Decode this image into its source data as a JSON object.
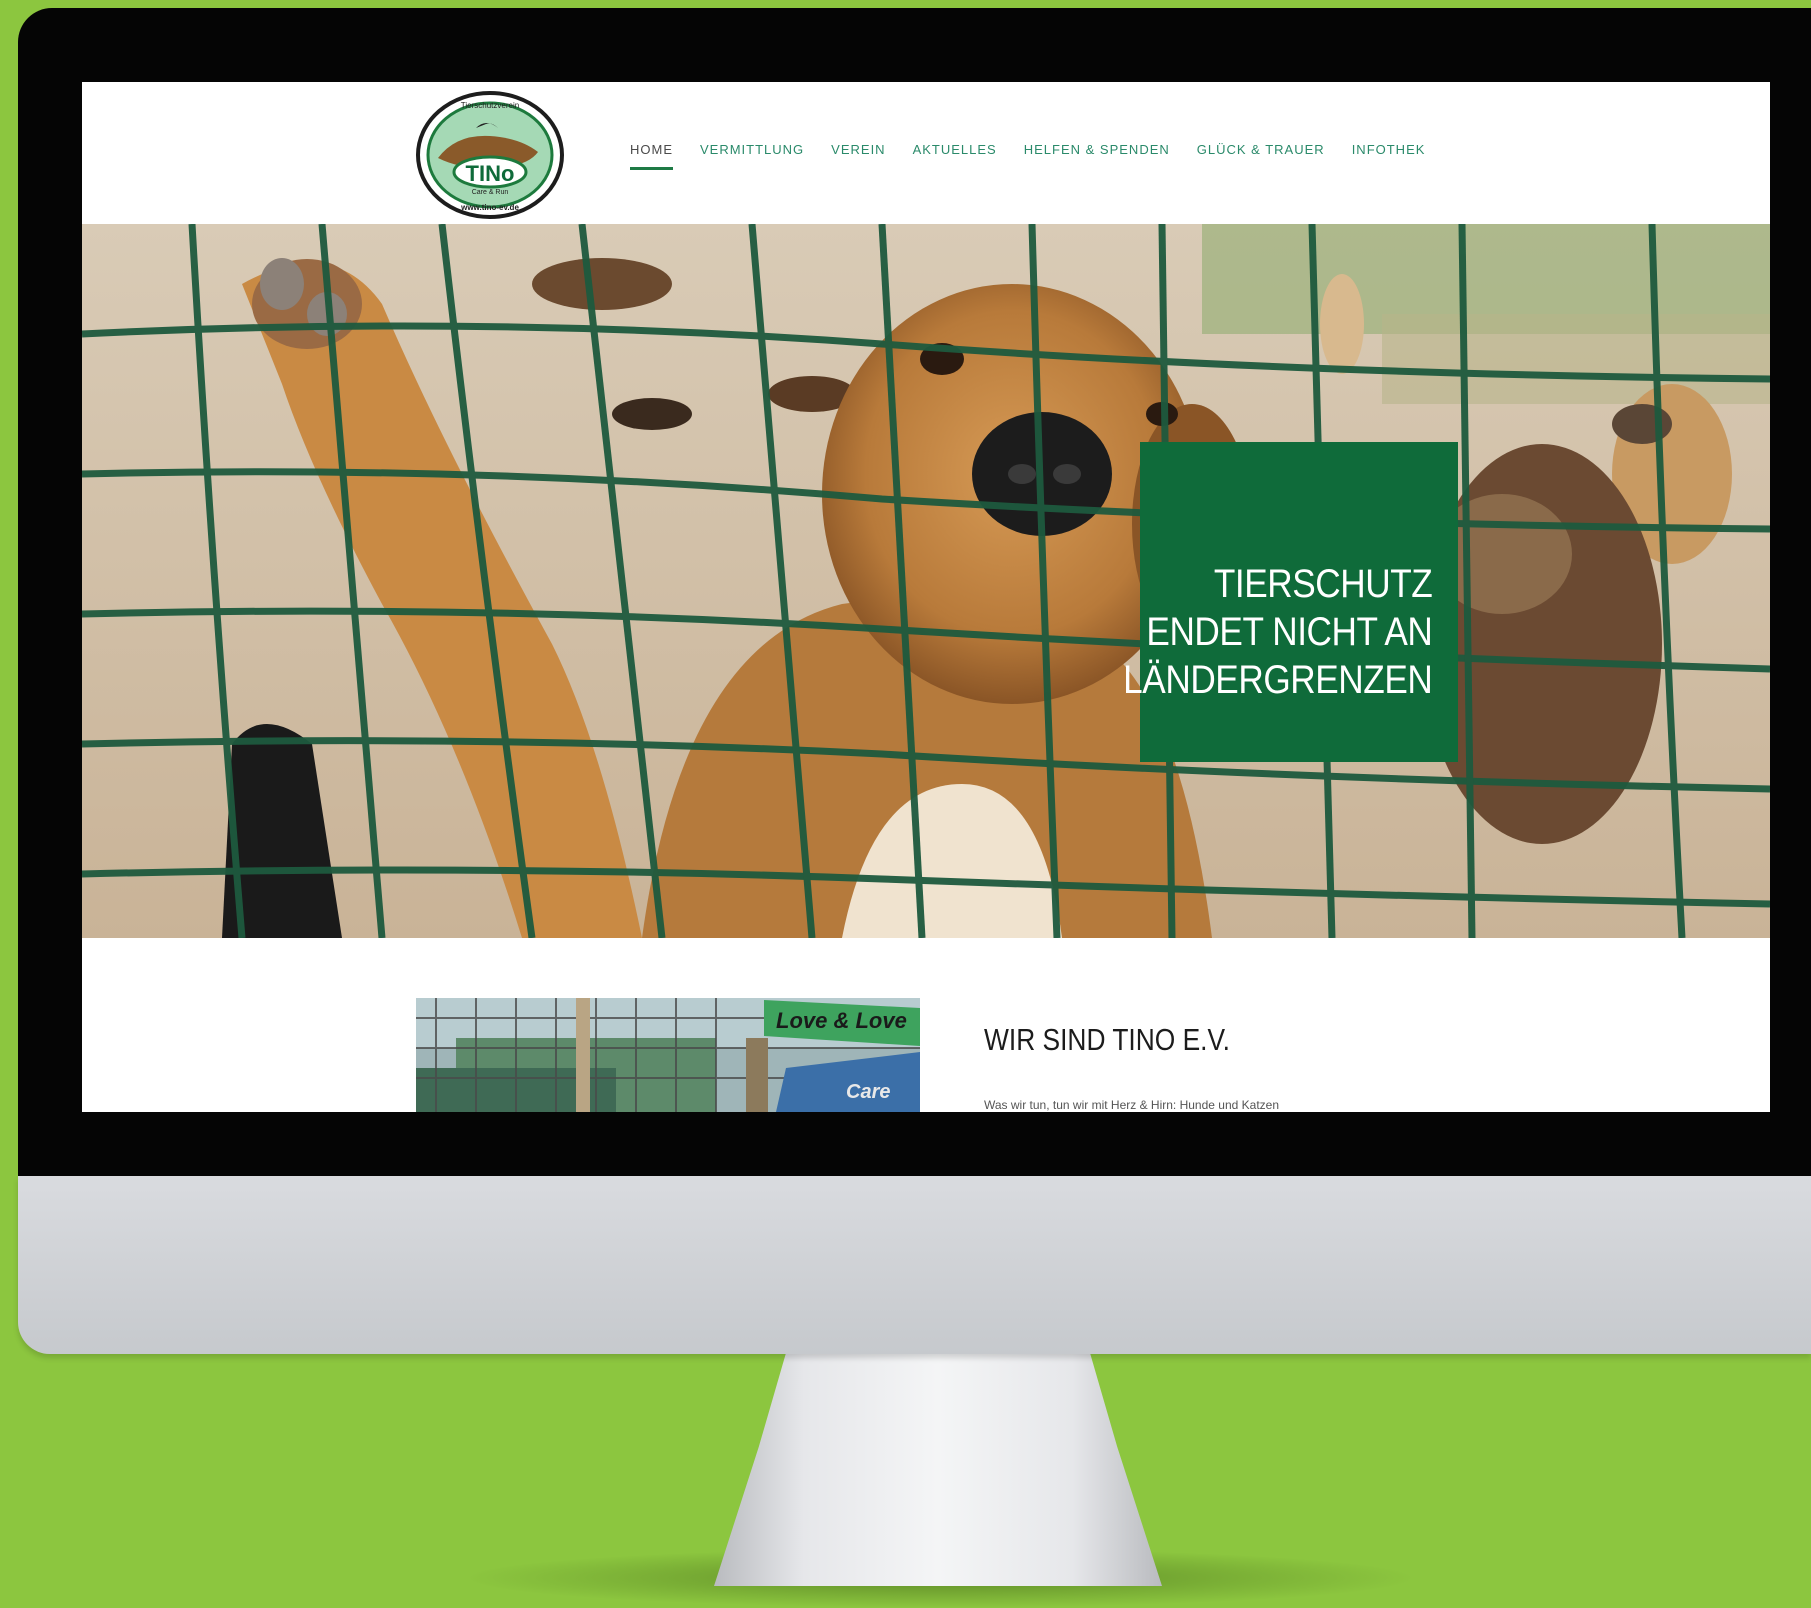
{
  "site": {
    "logo": {
      "top_text": "Tierschutzverein",
      "name": "TINo",
      "sub_text": "Care & Run",
      "url_text": "www.tino-ev.de"
    },
    "nav": [
      {
        "label": "HOME",
        "active": true
      },
      {
        "label": "VERMITTLUNG",
        "active": false
      },
      {
        "label": "VEREIN",
        "active": false
      },
      {
        "label": "AKTUELLES",
        "active": false
      },
      {
        "label": "HELFEN & SPENDEN",
        "active": false
      },
      {
        "label": "GLÜCK & TRAUER",
        "active": false
      },
      {
        "label": "INFOTHEK",
        "active": false
      }
    ]
  },
  "hero": {
    "lines": [
      "TIERSCHUTZ",
      "ENDET NICHT AN",
      "LÄNDERGRENZEN"
    ],
    "box_color": "#0f6b3a"
  },
  "intro": {
    "title": "WIR SIND TINO E.V.",
    "text": "Was wir tun, tun wir mit Herz & Hirn: Hunde und Katzen",
    "image_signs": [
      "Love & Love",
      "Care"
    ]
  },
  "colors": {
    "background": "#8cc63f",
    "accent": "#0f6b3a",
    "nav": "#2a8a6a"
  }
}
